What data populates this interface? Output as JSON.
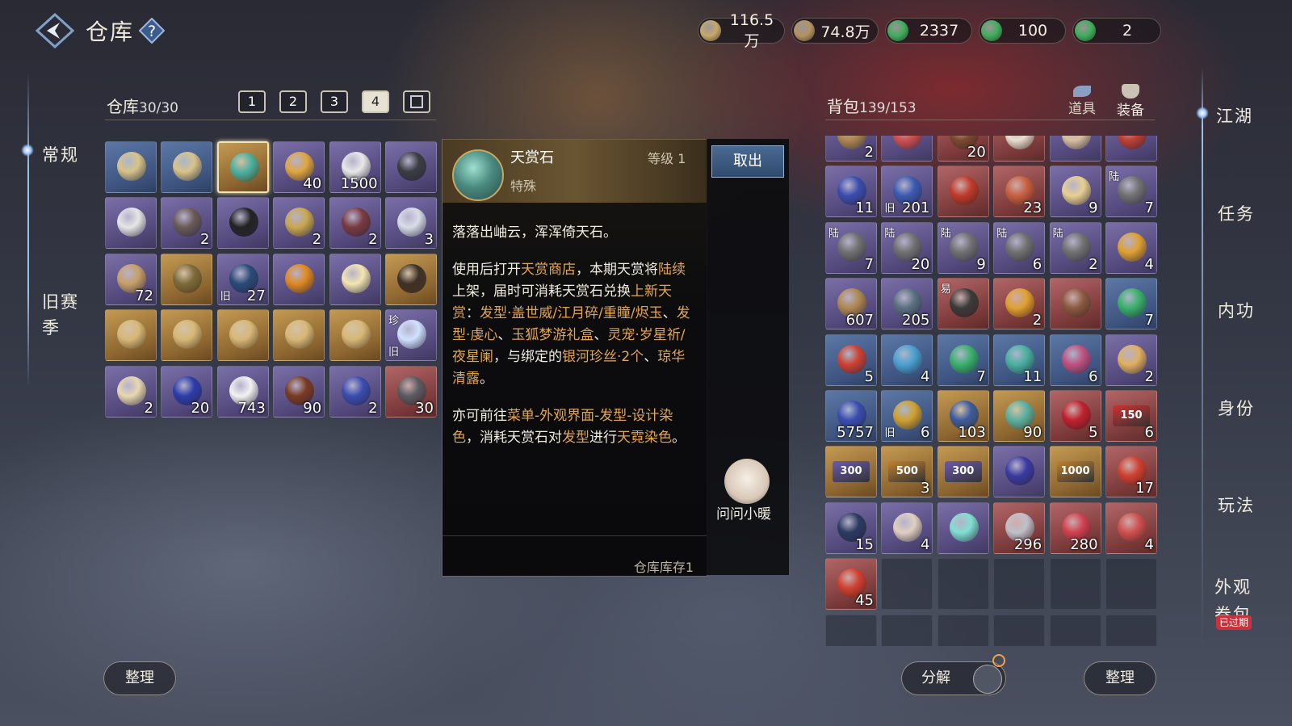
{
  "header": {
    "title": "仓库",
    "help_glyph": "?"
  },
  "currencies": [
    {
      "value": "116.5万",
      "color": "#c8a86a"
    },
    {
      "value": "74.8万",
      "color": "#b59260"
    },
    {
      "value": "2337",
      "color": "#3fae5c"
    },
    {
      "value": "100",
      "color": "#3fae5c"
    },
    {
      "value": "2",
      "color": "#3fae5c"
    }
  ],
  "left_nav": {
    "items": [
      "常规",
      "旧赛",
      "季"
    ]
  },
  "warehouse": {
    "label": "仓库",
    "capacity": "30/30",
    "tabs": [
      "1",
      "2",
      "3",
      "4"
    ],
    "active_tab": 3,
    "sort_button": "整理",
    "items": [
      {
        "q": "blue",
        "c": "#d9c38a"
      },
      {
        "q": "blue",
        "c": "#d9c38a"
      },
      {
        "q": "gold",
        "c": "#4bb0a0",
        "sel": true
      },
      {
        "q": "purple",
        "c": "#e0a640",
        "n": "40"
      },
      {
        "q": "purple",
        "c": "#e8e8e8",
        "n": "1500"
      },
      {
        "q": "purple",
        "c": "#3a3c42"
      },
      {
        "q": "purple",
        "c": "#e6e6e6"
      },
      {
        "q": "purple",
        "c": "#6a5a58",
        "n": "2"
      },
      {
        "q": "purple",
        "c": "#222"
      },
      {
        "q": "purple",
        "c": "#c9a84f",
        "n": "2"
      },
      {
        "q": "purple",
        "c": "#7a3a40",
        "n": "2"
      },
      {
        "q": "purple",
        "c": "#d8dde8",
        "n": "3"
      },
      {
        "q": "purple",
        "c": "#c7a068",
        "n": "72"
      },
      {
        "q": "gold",
        "c": "#7d6a3a"
      },
      {
        "q": "purple",
        "c": "#2a4a78",
        "n": "27",
        "tb": "旧"
      },
      {
        "q": "purple",
        "c": "#e08a20"
      },
      {
        "q": "purple",
        "c": "#f3e6b0"
      },
      {
        "q": "gold",
        "c": "#3d3026"
      },
      {
        "q": "gold",
        "c": "#d7b878"
      },
      {
        "q": "gold",
        "c": "#d7b878"
      },
      {
        "q": "gold",
        "c": "#d7b878"
      },
      {
        "q": "gold",
        "c": "#d7b878"
      },
      {
        "q": "gold",
        "c": "#d7b878"
      },
      {
        "q": "purple",
        "c": "#cfe2ff",
        "t": "珍",
        "tb": "旧"
      },
      {
        "q": "purple",
        "c": "#e8d8b0",
        "n": "2"
      },
      {
        "q": "purple",
        "c": "#2c3caa",
        "n": "20"
      },
      {
        "q": "purple",
        "c": "#f2f2f2",
        "n": "743"
      },
      {
        "q": "purple",
        "c": "#7a3a20",
        "n": "90"
      },
      {
        "q": "purple",
        "c": "#3a4cb0",
        "n": "2"
      },
      {
        "q": "red",
        "c": "#5a5a62",
        "n": "30"
      }
    ]
  },
  "tooltip": {
    "name": "天赏石",
    "level": "等级 1",
    "category": "特殊",
    "paragraphs": [
      [
        {
          "t": "落落出岫云，浑浑倚天石。"
        }
      ],
      [
        {
          "t": "使用后打开"
        },
        {
          "t": "天赏商店",
          "h": true
        },
        {
          "t": "，本期天赏将"
        },
        {
          "t": "陆续",
          "h": true
        },
        {
          "t": "上架，届时可消耗天赏石兑换"
        },
        {
          "t": "上新天赏",
          "h": true
        },
        {
          "t": "："
        },
        {
          "t": "发型·盖世威/江月碎/重瞳/烬玉",
          "h": true
        },
        {
          "t": "、"
        },
        {
          "t": "发型·虔心",
          "h": true
        },
        {
          "t": "、"
        },
        {
          "t": "玉狐梦游礼盒",
          "h": true
        },
        {
          "t": "、"
        },
        {
          "t": "灵宠·岁星祈/夜星阑",
          "h": true
        },
        {
          "t": "，与绑定的"
        },
        {
          "t": "银河珍丝·2个",
          "h": true
        },
        {
          "t": "、"
        },
        {
          "t": "琼华清露",
          "h": true
        },
        {
          "t": "。"
        }
      ],
      [
        {
          "t": "亦可前往"
        },
        {
          "t": "菜单-外观界面-发型-设计染色",
          "h": true
        },
        {
          "t": "，消耗天赏石对"
        },
        {
          "t": "发型",
          "h": true
        },
        {
          "t": "进行"
        },
        {
          "t": "天霓染色",
          "h": true
        },
        {
          "t": "。"
        }
      ]
    ],
    "stock": "仓库库存1",
    "take_out_button": "取出",
    "ask_label": "问问小暖"
  },
  "backpack": {
    "label": "背包",
    "capacity": "139/153",
    "tabs": [
      "道具",
      "装备"
    ],
    "decompose_button": "分解",
    "sort_button": "整理",
    "items": [
      {
        "q": "purple",
        "c": "#b08850",
        "n": "2"
      },
      {
        "q": "purple",
        "c": "#d05050"
      },
      {
        "q": "red",
        "c": "#7a4a30",
        "n": "20"
      },
      {
        "q": "red",
        "c": "#e8e0d0"
      },
      {
        "q": "purple",
        "c": "#d8c0a0"
      },
      {
        "q": "purple",
        "c": "#c04030"
      },
      {
        "q": "purple",
        "c": "#3a4cb0",
        "n": "11"
      },
      {
        "q": "purple",
        "c": "#3a5ab0",
        "n": "201",
        "tb": "旧"
      },
      {
        "q": "red",
        "c": "#c03a2a"
      },
      {
        "q": "red",
        "c": "#c86040",
        "n": "23"
      },
      {
        "q": "purple",
        "c": "#e8d090",
        "n": "9"
      },
      {
        "q": "purple",
        "c": "#707070",
        "n": "7",
        "t": "陆"
      },
      {
        "q": "purple",
        "c": "#707070",
        "n": "7",
        "t": "陆"
      },
      {
        "q": "purple",
        "c": "#707070",
        "n": "20",
        "t": "陆"
      },
      {
        "q": "purple",
        "c": "#707070",
        "n": "9",
        "t": "陆"
      },
      {
        "q": "purple",
        "c": "#707070",
        "n": "6",
        "t": "陆"
      },
      {
        "q": "purple",
        "c": "#707070",
        "n": "2",
        "t": "陆"
      },
      {
        "q": "purple",
        "c": "#e0a030",
        "n": "4"
      },
      {
        "q": "purple",
        "c": "#b08850",
        "n": "607"
      },
      {
        "q": "purple",
        "c": "#5a7080",
        "n": "205"
      },
      {
        "q": "red",
        "c": "#3a3a3a",
        "t": "易"
      },
      {
        "q": "red",
        "c": "#e0a030",
        "n": "2"
      },
      {
        "q": "red",
        "c": "#8a5a40"
      },
      {
        "q": "blue",
        "c": "#3ab06a",
        "n": "7"
      },
      {
        "q": "blue",
        "c": "#d04030",
        "n": "5"
      },
      {
        "q": "blue",
        "c": "#4aa0d0",
        "n": "4"
      },
      {
        "q": "blue",
        "c": "#3ab06a",
        "n": "7"
      },
      {
        "q": "blue",
        "c": "#4ab0a0",
        "n": "11"
      },
      {
        "q": "blue",
        "c": "#c05080",
        "n": "6"
      },
      {
        "q": "purple",
        "c": "#e0b060",
        "n": "2"
      },
      {
        "q": "blue",
        "c": "#3a4cb0",
        "n": "5757"
      },
      {
        "q": "blue",
        "c": "#d0a030",
        "n": "6",
        "tb": "旧"
      },
      {
        "q": "gold",
        "c": "#3a5aa0",
        "n": "103"
      },
      {
        "q": "gold",
        "c": "#5ab0a0",
        "n": "90"
      },
      {
        "q": "red",
        "c": "#c02030",
        "n": "5"
      },
      {
        "q": "red",
        "c": "#d03030",
        "n": "6",
        "coupon": "150"
      },
      {
        "q": "gold",
        "c": "#6a5ab0",
        "coupon": "300"
      },
      {
        "q": "gold",
        "c": "#c08030",
        "n": "3",
        "coupon": "500"
      },
      {
        "q": "gold",
        "c": "#6a5ab0",
        "coupon": "300"
      },
      {
        "q": "purple",
        "c": "#3a3aa0"
      },
      {
        "q": "gold",
        "c": "#c08030",
        "coupon": "1000"
      },
      {
        "q": "red",
        "c": "#d04030",
        "n": "17"
      },
      {
        "q": "purple",
        "c": "#2a3a60",
        "n": "15"
      },
      {
        "q": "purple",
        "c": "#e0d0c0",
        "n": "4"
      },
      {
        "q": "purple",
        "c": "#80e0d0"
      },
      {
        "q": "red",
        "c": "#c0c0c8",
        "n": "296"
      },
      {
        "q": "red",
        "c": "#d04050",
        "n": "280"
      },
      {
        "q": "red",
        "c": "#d05050",
        "n": "4"
      },
      {
        "q": "red",
        "c": "#d04030",
        "n": "45"
      },
      {
        "q": "empty"
      },
      {
        "q": "empty"
      },
      {
        "q": "empty"
      },
      {
        "q": "empty"
      },
      {
        "q": "empty"
      },
      {
        "q": "empty"
      },
      {
        "q": "empty"
      },
      {
        "q": "empty"
      },
      {
        "q": "empty"
      },
      {
        "q": "empty"
      },
      {
        "q": "empty"
      }
    ]
  },
  "right_nav": {
    "items": [
      "江湖",
      "任务",
      "内功",
      "身份",
      "玩法",
      "外观",
      "券包"
    ],
    "badge": "已过期"
  }
}
